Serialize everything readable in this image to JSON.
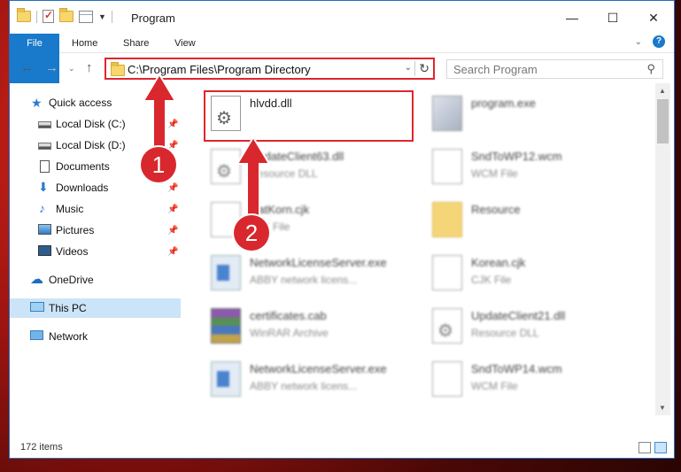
{
  "titlebar": {
    "title": "Program",
    "minimize_label": "—",
    "maximize_label": "☐",
    "close_label": "✕"
  },
  "ribbon": {
    "tabs": [
      "File",
      "Home",
      "Share",
      "View"
    ],
    "help_label": "?"
  },
  "nav": {
    "address": "C:\\Program Files\\Program Directory",
    "search_placeholder": "Search Program"
  },
  "sidebar": {
    "items": [
      {
        "label": "Quick access",
        "icon": "star-icon"
      },
      {
        "label": "Local Disk (C:)",
        "icon": "drive-icon"
      },
      {
        "label": "Local Disk (D:)",
        "icon": "drive-icon"
      },
      {
        "label": "Documents",
        "icon": "documents-icon"
      },
      {
        "label": "Downloads",
        "icon": "download-icon"
      },
      {
        "label": "Music",
        "icon": "music-icon"
      },
      {
        "label": "Pictures",
        "icon": "pictures-icon"
      },
      {
        "label": "Videos",
        "icon": "videos-icon"
      },
      {
        "label": "OneDrive",
        "icon": "onedrive-icon"
      },
      {
        "label": "This PC",
        "icon": "this-pc-icon"
      },
      {
        "label": "Network",
        "icon": "network-icon"
      }
    ]
  },
  "files": [
    {
      "name": "hlvdd.dll",
      "type": "",
      "icon": "dll-gear-icon"
    },
    {
      "name": "program.exe",
      "type": "",
      "icon": "exe-icon"
    },
    {
      "name": "UpdateClient63.dll",
      "type": "Resource DLL",
      "icon": "dll-gear-icon"
    },
    {
      "name": "SndToWP12.wcm",
      "type": "WCM File",
      "icon": "document-icon"
    },
    {
      "name": "CatKorn.cjk",
      "type": "CJK File",
      "icon": "document-icon"
    },
    {
      "name": "Resource",
      "type": "",
      "icon": "folder-icon"
    },
    {
      "name": "NetworkLicenseServer.exe",
      "type": "ABBY network licens...",
      "icon": "app-icon"
    },
    {
      "name": "Korean.cjk",
      "type": "CJK File",
      "icon": "document-icon"
    },
    {
      "name": "certificates.cab",
      "type": "WinRAR Archive",
      "icon": "winrar-icon"
    },
    {
      "name": "UpdateClient21.dll",
      "type": "Resource DLL",
      "icon": "dll-gear-icon"
    },
    {
      "name": "NetworkLicenseServer.exe",
      "type": "ABBY network licens...",
      "icon": "app-icon"
    },
    {
      "name": "SndToWP14.wcm",
      "type": "WCM File",
      "icon": "document-icon"
    }
  ],
  "status": {
    "item_count": "172 items"
  },
  "callouts": {
    "step1": "1",
    "step2": "2"
  },
  "colors": {
    "accent": "#1979ca",
    "highlight": "#e0262e",
    "badge": "#d9272e"
  }
}
